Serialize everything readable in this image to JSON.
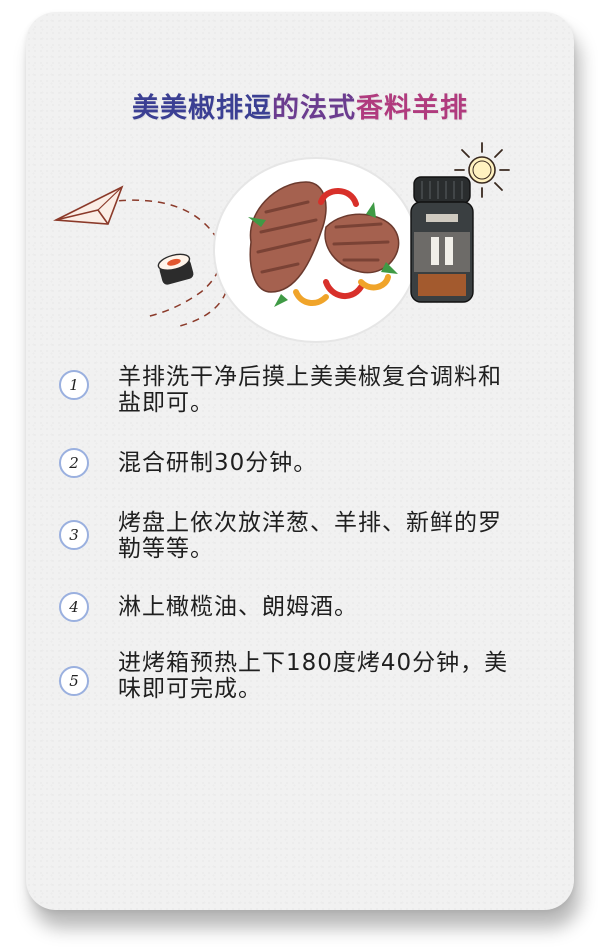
{
  "title": {
    "part1": "美美椒排逗",
    "part2": "的法式",
    "part3": "香料羊排"
  },
  "steps": [
    {
      "number": "1",
      "text": "羊排洗干净后摸上美美椒复合调料和盐即可。"
    },
    {
      "number": "2",
      "text": "混合研制30分钟。"
    },
    {
      "number": "3",
      "text": "烤盘上依次放洋葱、羊排、新鲜的罗勒等等。"
    },
    {
      "number": "4",
      "text": "淋上橄榄油、朗姆酒。"
    },
    {
      "number": "5",
      "text": "进烤箱预热上下180度烤40分钟，美味即可完成。"
    }
  ],
  "colors": {
    "title_blue": "#3b3f93",
    "title_purple": "#6b3c8f",
    "title_pink": "#b03b7e",
    "number_ring": "#9ab0df",
    "card_bg": "#f1f1f1"
  },
  "icons": [
    "paper-plane-icon",
    "sushi-roll-icon",
    "sun-icon",
    "steak-plate-icon",
    "spice-jar-icon"
  ]
}
